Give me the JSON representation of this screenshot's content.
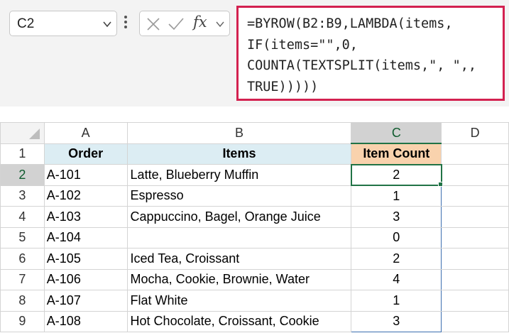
{
  "name_box": {
    "value": "C2"
  },
  "formula_bar": {
    "fx_label": "fx",
    "formula_lines": [
      "=BYROW(B2:B9,LAMBDA(items,",
      "IF(items=\"\",0,",
      "COUNTA(TEXTSPLIT(items,\", \",,",
      "TRUE)))))"
    ]
  },
  "grid": {
    "column_headers": [
      "A",
      "B",
      "C",
      "D"
    ],
    "selected_column": "C",
    "header_row": {
      "row_num": "1",
      "order": "Order",
      "items": "Items",
      "count": "Item Count"
    },
    "rows": [
      {
        "row_num": "2",
        "order": "A-101",
        "items": "Latte, Blueberry Muffin",
        "count": "2"
      },
      {
        "row_num": "3",
        "order": "A-102",
        "items": "Espresso",
        "count": "1"
      },
      {
        "row_num": "4",
        "order": "A-103",
        "items": "Cappuccino, Bagel, Orange Juice",
        "count": "3"
      },
      {
        "row_num": "5",
        "order": "A-104",
        "items": "",
        "count": "0"
      },
      {
        "row_num": "6",
        "order": "A-105",
        "items": "Iced Tea, Croissant",
        "count": "2"
      },
      {
        "row_num": "7",
        "order": "A-106",
        "items": "Mocha, Cookie, Brownie, Water",
        "count": "4"
      },
      {
        "row_num": "8",
        "order": "A-107",
        "items": "Flat White",
        "count": "1"
      },
      {
        "row_num": "9",
        "order": "A-108",
        "items": "Hot Chocolate, Croissant, Cookie",
        "count": "3"
      }
    ]
  },
  "colors": {
    "formula_border": "#d32150",
    "header_blue": "#dcedf3",
    "header_orange": "#f9d2ad",
    "selection_green": "#217346",
    "range_blue": "#3d6fb0"
  }
}
